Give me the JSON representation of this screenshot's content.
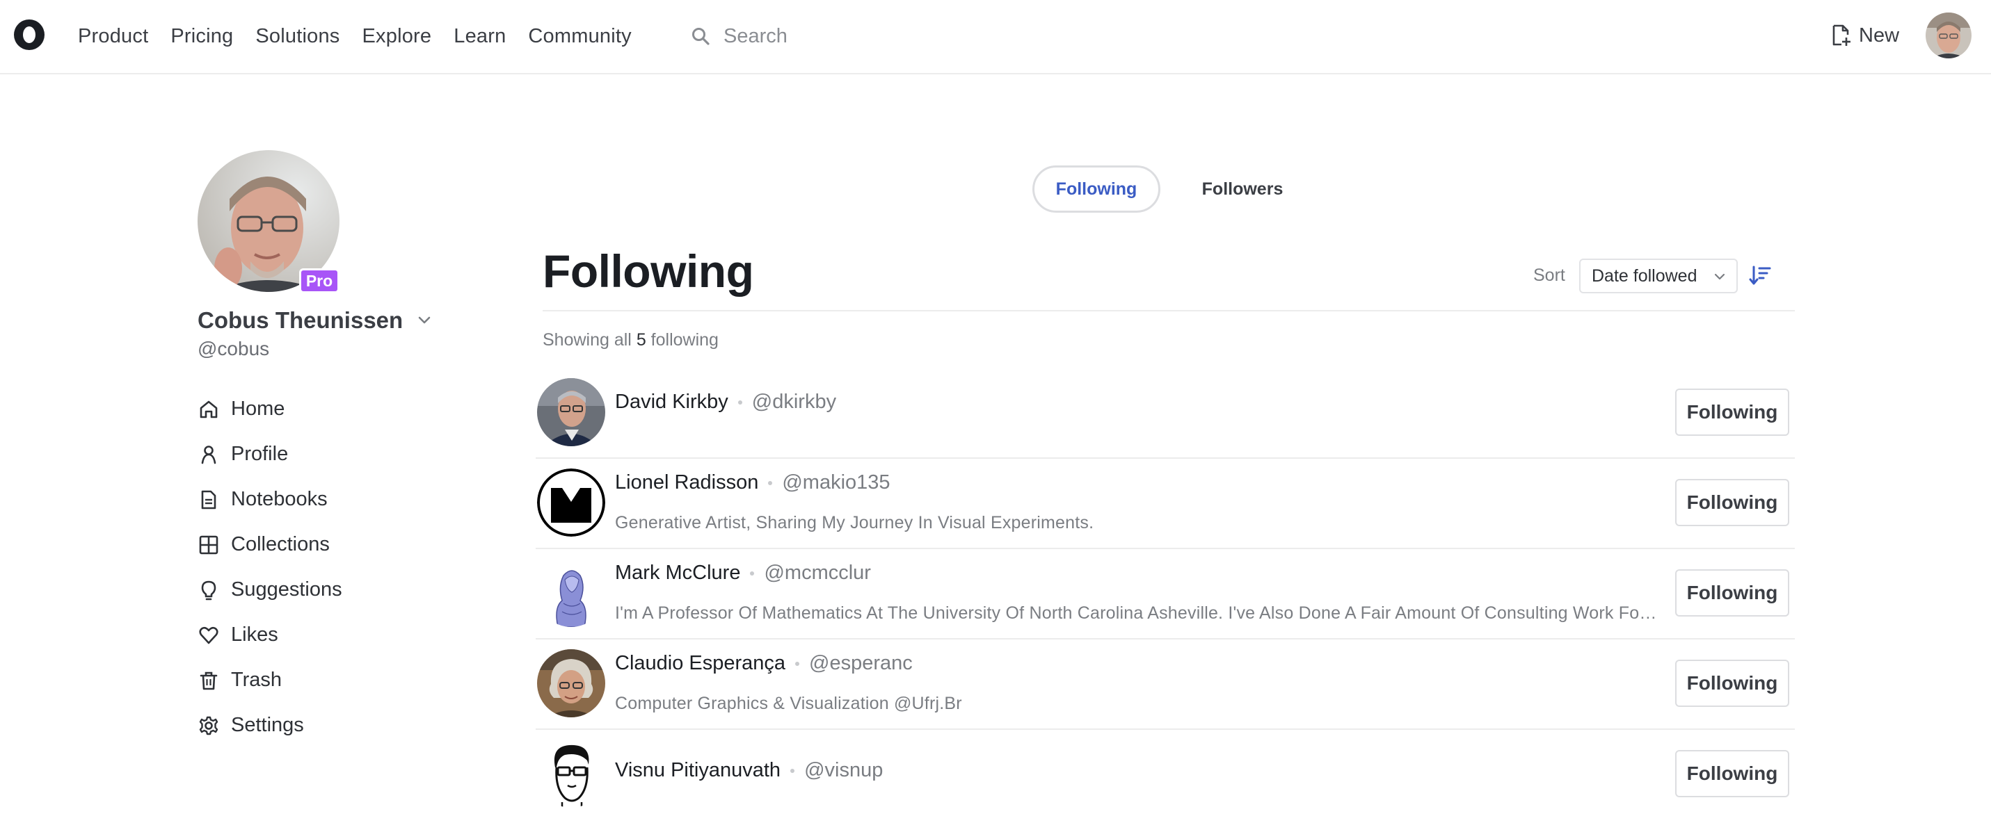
{
  "nav": {
    "links": [
      "Product",
      "Pricing",
      "Solutions",
      "Explore",
      "Learn",
      "Community"
    ],
    "search_placeholder": "Search",
    "new_label": "New"
  },
  "profile": {
    "name": "Cobus Theunissen",
    "handle": "@cobus",
    "badge": "Pro",
    "badge_color": "#a855f7"
  },
  "sidebar": {
    "items": [
      {
        "label": "Home",
        "icon": "home-icon"
      },
      {
        "label": "Profile",
        "icon": "person-icon"
      },
      {
        "label": "Notebooks",
        "icon": "notebook-icon"
      },
      {
        "label": "Collections",
        "icon": "grid-icon"
      },
      {
        "label": "Suggestions",
        "icon": "lightbulb-icon"
      },
      {
        "label": "Likes",
        "icon": "heart-icon"
      },
      {
        "label": "Trash",
        "icon": "trash-icon"
      },
      {
        "label": "Settings",
        "icon": "gear-icon"
      }
    ]
  },
  "tabs": {
    "following": "Following",
    "followers": "Followers",
    "active": "Following"
  },
  "main": {
    "title": "Following",
    "sort_label": "Sort",
    "sort_value": "Date followed",
    "showing_prefix": "Showing all",
    "showing_count": "5",
    "showing_suffix": "following"
  },
  "following": [
    {
      "name": "David Kirkby",
      "handle": "@dkirkby",
      "bio": "",
      "button": "Following"
    },
    {
      "name": "Lionel Radisson",
      "handle": "@makio135",
      "bio": "Generative Artist, Sharing My Journey In Visual Experiments.",
      "button": "Following"
    },
    {
      "name": "Mark McClure",
      "handle": "@mcmcclur",
      "bio": "I'm A Professor Of Mathematics At The University Of North Carolina Asheville. I've Also Done A Fair Amount Of Consulting Work For Various Companies",
      "button": "Following"
    },
    {
      "name": "Claudio Esperança",
      "handle": "@esperanc",
      "bio": "Computer Graphics & Visualization @Ufrj.Br",
      "button": "Following"
    },
    {
      "name": "Visnu Pitiyanuvath",
      "handle": "@visnup",
      "bio": "",
      "button": "Following"
    }
  ],
  "colors": {
    "accent": "#3b5cc4",
    "text": "#1b1e23",
    "muted": "#7a7d82",
    "border": "#dcdde0"
  }
}
